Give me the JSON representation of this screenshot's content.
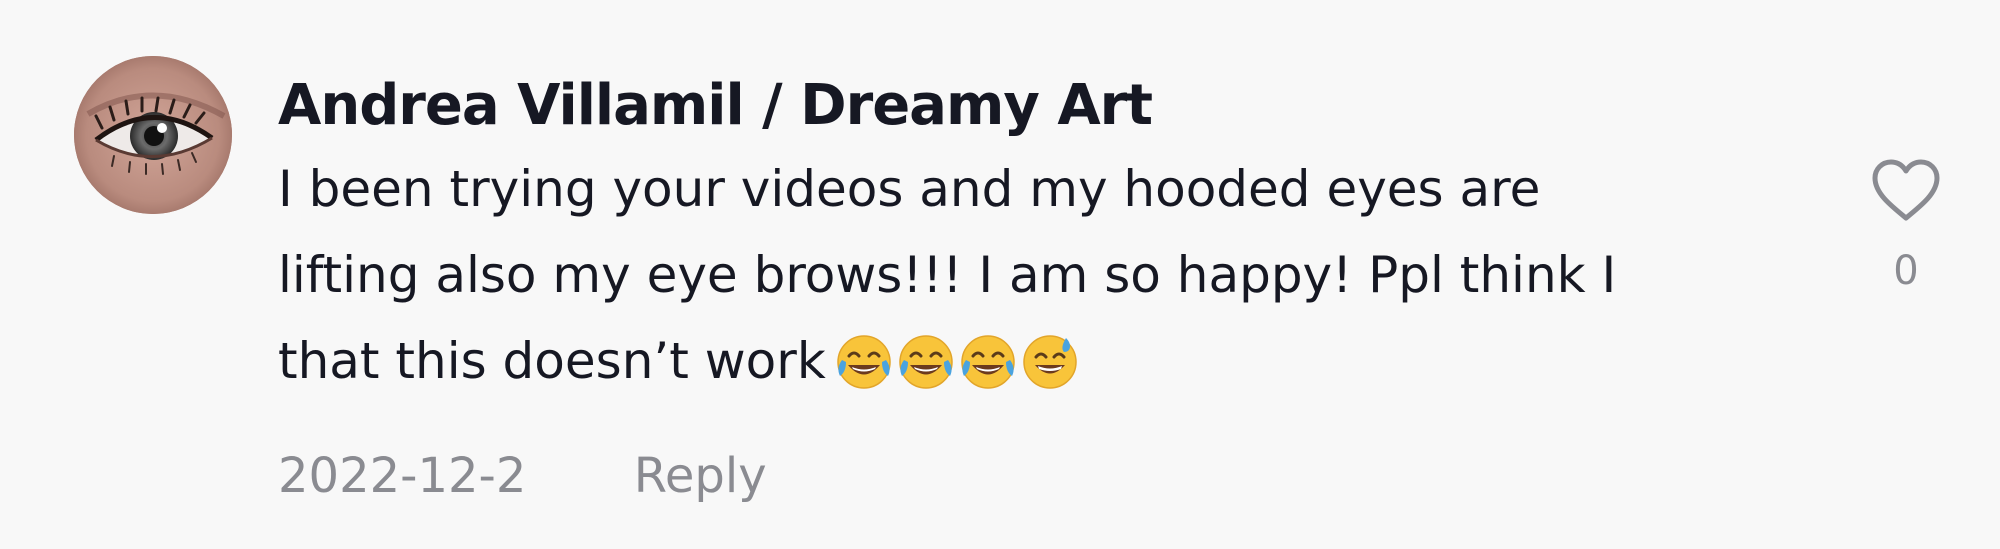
{
  "comment": {
    "username": "Andrea Villamil / Dreamy Art",
    "text_lines": [
      "I been trying your videos and my hooded eyes are",
      "lifting also my eye brows!!! I am so happy! Ppl think I",
      "that this doesn’t work"
    ],
    "emojis": [
      "face-with-tears-of-joy",
      "face-with-tears-of-joy",
      "face-with-tears-of-joy",
      "grinning-face-with-sweat"
    ],
    "date": "2022-12-2",
    "reply_label": "Reply",
    "like_count": "0",
    "avatar_icon": "eye-avatar-icon"
  },
  "colors": {
    "background": "#f8f8f8",
    "text_primary": "#161823",
    "text_secondary": "#8a8b91",
    "heart_outline": "#8a8b91",
    "emoji_yellow": "#f8c43a",
    "emoji_tears": "#4aa3df"
  }
}
